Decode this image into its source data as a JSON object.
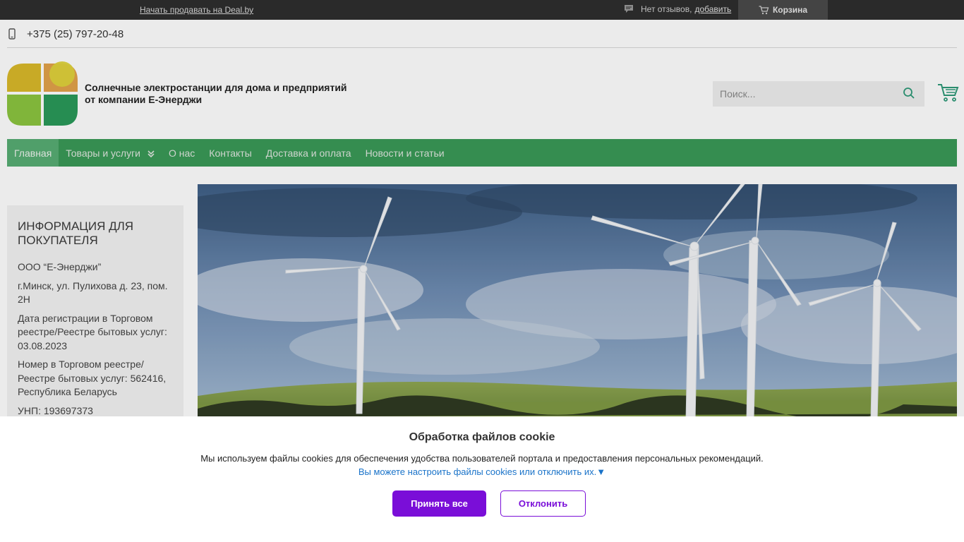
{
  "topbar": {
    "sell_link": "Начать продавать на Deal.by",
    "reviews_text": "Нет отзывов,",
    "reviews_add": "добавить",
    "cart_label": "Корзина"
  },
  "contact": {
    "phone": "+375 (25) 797-20-48"
  },
  "header": {
    "brand_line1": "Солнечные электростанции для дома и предприятий",
    "brand_line2": "от компании Е-Энерджи",
    "search_placeholder": "Поиск..."
  },
  "nav": {
    "items": [
      {
        "label": "Главная",
        "active": true
      },
      {
        "label": "Товары и услуги",
        "has_dropdown": true
      },
      {
        "label": "О нас"
      },
      {
        "label": "Контакты"
      },
      {
        "label": "Доставка и оплата"
      },
      {
        "label": "Новости и статьи"
      }
    ]
  },
  "sidebar": {
    "title": "ИНФОРМАЦИЯ ДЛЯ ПОКУПАТЕЛЯ",
    "lines": [
      "ООО “Е-Энерджи”",
      "г.Минск, ул. Пулихова д. 23, пом. 2Н",
      "Дата регистрации в Торговом реестре/Реестре бытовых услуг: 03.08.2023",
      "Номер в Торговом реестре/ Реестре бытовых услуг: 562416, Республика Беларусь",
      "УНП: 193697373"
    ]
  },
  "banner": {
    "image": "wind-turbines-field"
  },
  "cookie": {
    "title": "Обработка файлов cookie",
    "description": "Мы используем файлы cookies для обеспечения удобства пользователей портала и предоставления персональных рекомендаций.",
    "settings_link": "Вы можете настроить файлы cookies или отключить их.▼",
    "accept_label": "Принять все",
    "decline_label": "Отклонить"
  },
  "colors": {
    "topbar": "#2e2e2e",
    "nav": "#3a9a57",
    "nav_active": "#57ad74",
    "accent_purple": "#7a0ed8",
    "link_blue": "#1a73c9",
    "icon_green": "#2e9a78"
  }
}
